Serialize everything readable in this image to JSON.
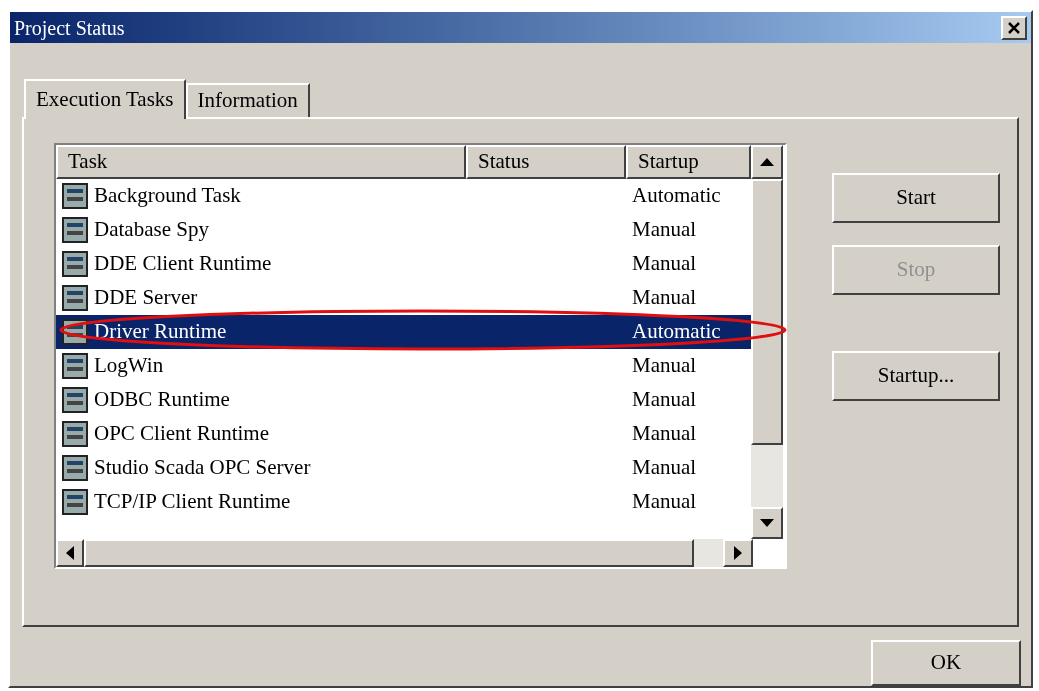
{
  "window": {
    "title": "Project Status"
  },
  "tabs": [
    {
      "label": "Execution Tasks",
      "selected": true
    },
    {
      "label": "Information",
      "selected": false
    }
  ],
  "table": {
    "columns": [
      "Task",
      "Status",
      "Startup"
    ],
    "rows": [
      {
        "task": "Background Task",
        "startup": "Automatic",
        "selected": false
      },
      {
        "task": "Database Spy",
        "startup": "Manual",
        "selected": false
      },
      {
        "task": "DDE Client Runtime",
        "startup": "Manual",
        "selected": false
      },
      {
        "task": "DDE Server",
        "startup": "Manual",
        "selected": false
      },
      {
        "task": "Driver Runtime",
        "startup": "Automatic",
        "selected": true
      },
      {
        "task": "LogWin",
        "startup": "Manual",
        "selected": false
      },
      {
        "task": "ODBC Runtime",
        "startup": "Manual",
        "selected": false
      },
      {
        "task": "OPC Client Runtime",
        "startup": "Manual",
        "selected": false
      },
      {
        "task": "Studio Scada OPC Server",
        "startup": "Manual",
        "selected": false
      },
      {
        "task": "TCP/IP Client Runtime",
        "startup": "Manual",
        "selected": false
      }
    ]
  },
  "side_buttons": [
    {
      "label": "Start",
      "disabled": false
    },
    {
      "label": "Stop",
      "disabled": true
    },
    {
      "label": "Startup...",
      "disabled": false
    }
  ],
  "buttons": [
    "OK"
  ]
}
